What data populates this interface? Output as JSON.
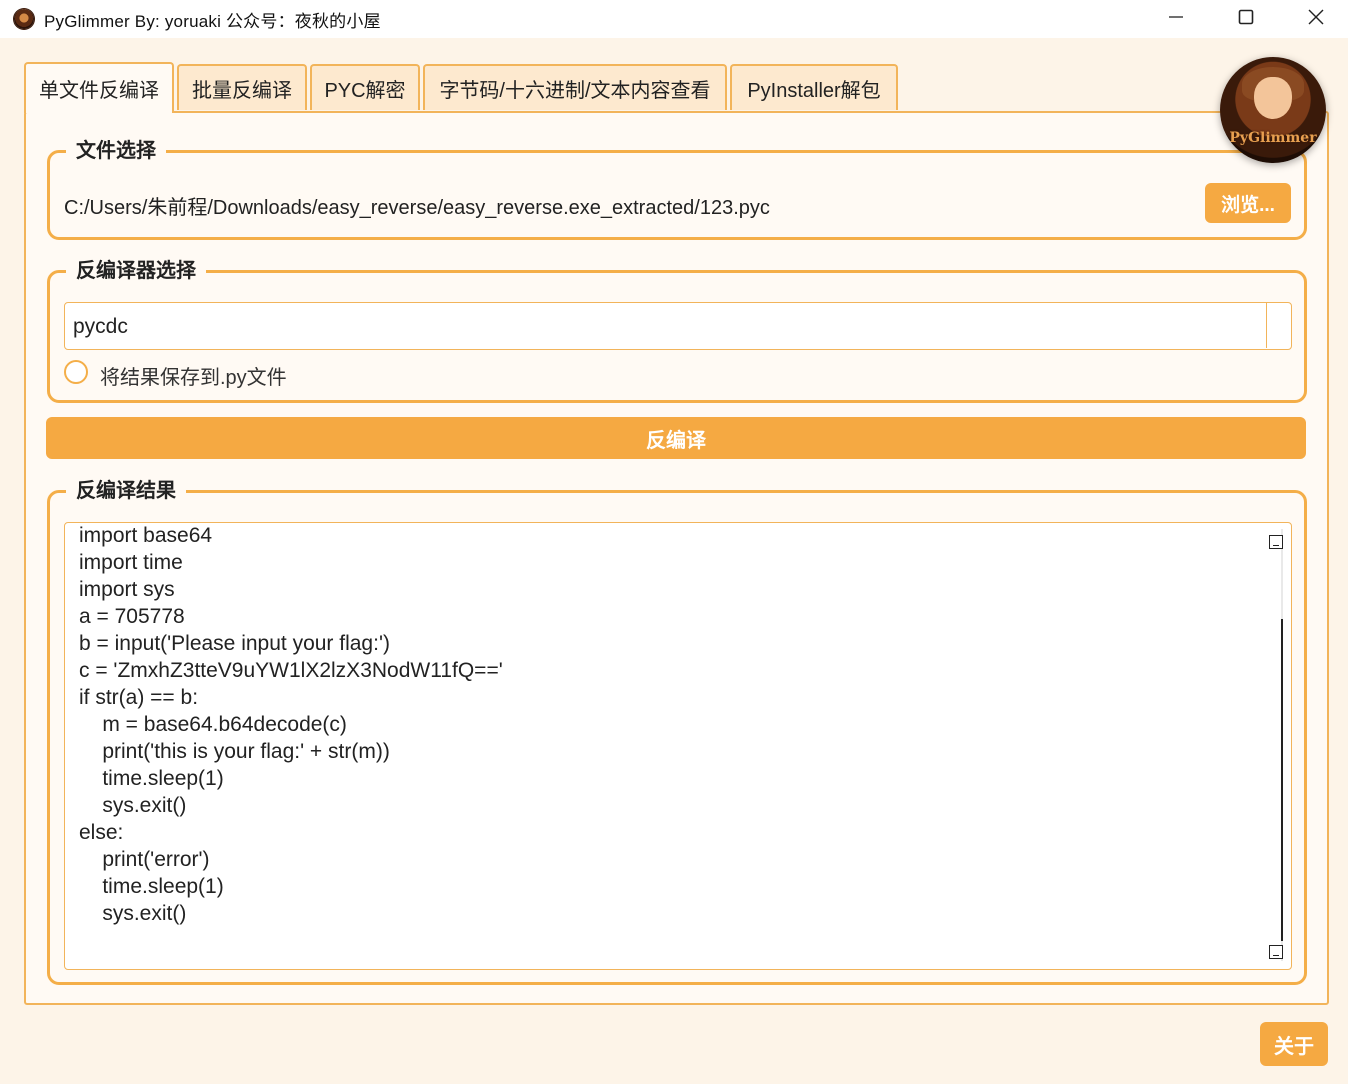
{
  "window": {
    "title": "PyGlimmer  By: yoruaki  公众号：夜秋的小屋"
  },
  "tabs": [
    {
      "label": "单文件反编译",
      "active": true
    },
    {
      "label": "批量反编译",
      "active": false
    },
    {
      "label": "PYC解密",
      "active": false
    },
    {
      "label": "字节码/十六进制/文本内容查看",
      "active": false
    },
    {
      "label": "PyInstaller解包",
      "active": false
    }
  ],
  "file_select": {
    "title": "文件选择",
    "path": "C:/Users/朱前程/Downloads/easy_reverse/easy_reverse.exe_extracted/123.pyc",
    "browse_label": "浏览..."
  },
  "decompiler_select": {
    "title": "反编译器选择",
    "selected": "pycdc",
    "save_checkbox_label": "将结果保存到.py文件",
    "save_checked": false
  },
  "decompile_button": "反编译",
  "result": {
    "title": "反编译结果",
    "code": "import base64\nimport time\nimport sys\na = 705778\nb = input('Please input your flag:')\nc = 'ZmxhZ3tteV9uYW1lX2lzX3NodW11fQ=='\nif str(a) == b:\n    m = base64.b64decode(c)\n    print('this is your flag:' + str(m))\n    time.sleep(1)\n    sys.exit()\nelse:\n    print('error')\n    time.sleep(1)\n    sys.exit()"
  },
  "about_button": "关于",
  "avatar_logo_text": "PyGlimmer",
  "colors": {
    "accent": "#f5a942",
    "border": "#f2b45a",
    "background": "#fdf4e8",
    "tab_inactive": "#fde9cf"
  }
}
